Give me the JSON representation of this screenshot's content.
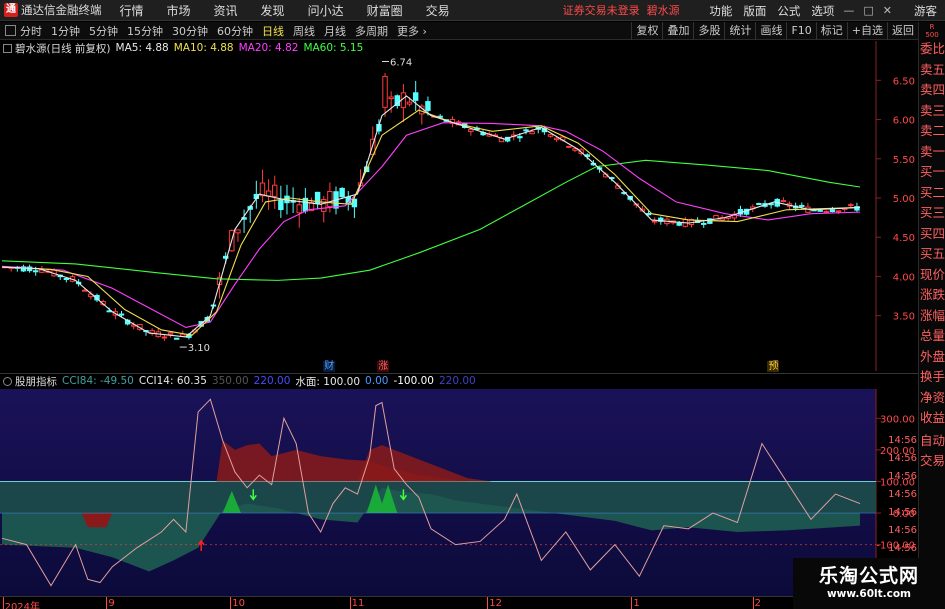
{
  "app": {
    "logo_glyph": "通",
    "title": "通达信金融终端",
    "menus": [
      "行情",
      "市场",
      "资讯",
      "发现",
      "问小达",
      "财富圈",
      "交易"
    ],
    "status": "证券交易未登录",
    "stock": "碧水源",
    "right_menus": [
      "功能",
      "版面",
      "公式",
      "选项"
    ],
    "win_buttons": [
      "—",
      "□",
      "✕"
    ],
    "guest": "游客"
  },
  "toolbar": {
    "timeframes": [
      "分时",
      "1分钟",
      "5分钟",
      "15分钟",
      "30分钟",
      "60分钟",
      "日线",
      "周线",
      "月线",
      "多周期",
      "更多"
    ],
    "active": "日线",
    "more_chevron": "›",
    "right_buttons": [
      "复权",
      "叠加",
      "多股",
      "统计",
      "画线",
      "F10",
      "标记",
      "+自选",
      "返回"
    ]
  },
  "right_panel": {
    "badge_top": "R",
    "badge_bottom": "500",
    "labels": [
      "委比",
      "卖五",
      "卖四",
      "卖三",
      "卖二",
      "卖一",
      "买一",
      "买二",
      "买三",
      "买四",
      "买五",
      "现价",
      "涨跌",
      "涨幅",
      "总量",
      "外盘",
      "换手",
      "净资",
      "收益"
    ],
    "zd_labels": [
      "自动",
      "交易"
    ],
    "times": [
      "14:56",
      "14:56",
      "14:56",
      "14:56",
      "14:56",
      "14:56",
      "14:56",
      "14:56"
    ]
  },
  "main_legend": {
    "title": "碧水源(日线 前复权)",
    "items": [
      {
        "text": "MA5: 4.88",
        "color": "#e8e8e8"
      },
      {
        "text": "MA10: 4.88",
        "color": "#f0e050"
      },
      {
        "text": "MA20: 4.82",
        "color": "#ff40ff"
      },
      {
        "text": "MA60: 5.15",
        "color": "#40ff40"
      }
    ]
  },
  "events": [
    {
      "text": "财",
      "color": "#4aa0ff",
      "bg": "#0a1a3a",
      "at": 0.352
    },
    {
      "text": "涨",
      "color": "#ff6060",
      "bg": "#3a0a0a",
      "at": 0.411
    },
    {
      "text": "预",
      "color": "#ffd040",
      "bg": "#3a2a00",
      "at": 0.836
    }
  ],
  "ind_legend": {
    "title": "股朋指标",
    "items": [
      {
        "text": "CCI84: -49.50",
        "color": "#40a0a0"
      },
      {
        "text": "CCI14: 60.35",
        "color": "#e8e8e8"
      },
      {
        "text": "350.00",
        "color": "#555555"
      },
      {
        "text": "220.00",
        "color": "#4a4aff"
      },
      {
        "text": "水面: 100.00",
        "color": "#e8e8e8"
      },
      {
        "text": "0.00",
        "color": "#4a9aff"
      },
      {
        "text": "-100.00",
        "color": "#ffffff"
      },
      {
        "text": "220.00",
        "color": "#4040c0"
      }
    ]
  },
  "dates": [
    {
      "text": "2024年",
      "at": 0.005
    },
    {
      "text": "9",
      "at": 0.118
    },
    {
      "text": "10",
      "at": 0.253
    },
    {
      "text": "11",
      "at": 0.383
    },
    {
      "text": "12",
      "at": 0.533
    },
    {
      "text": "1",
      "at": 0.69
    },
    {
      "text": "2",
      "at": 0.822
    }
  ],
  "watermark": {
    "line1": "乐淘公式网",
    "line2": "www.60lt.com"
  },
  "chart_data": [
    {
      "type": "candlestick",
      "x_range": [
        0,
        140
      ],
      "ylim": [
        3.05,
        6.95
      ],
      "y_ticks": [
        3.5,
        4.0,
        4.5,
        5.0,
        5.5,
        6.0,
        6.5
      ],
      "annotations": [
        {
          "text": "6.74",
          "x": 62,
          "y": 6.74
        },
        {
          "text": "3.10",
          "x": 29,
          "y": 3.1
        }
      ],
      "ohlc": [],
      "ma": [
        {
          "name": "MA60",
          "color": "#40ff40",
          "values": [
            [
              0,
              4.2
            ],
            [
              12,
              4.16
            ],
            [
              25,
              4.05
            ],
            [
              35,
              3.97
            ],
            [
              45,
              3.95
            ],
            [
              52,
              3.98
            ],
            [
              60,
              4.08
            ],
            [
              68,
              4.3
            ],
            [
              78,
              4.6
            ],
            [
              85,
              4.9
            ],
            [
              92,
              5.2
            ],
            [
              97,
              5.4
            ],
            [
              105,
              5.48
            ],
            [
              115,
              5.42
            ],
            [
              125,
              5.35
            ],
            [
              135,
              5.2
            ],
            [
              140,
              5.14
            ]
          ]
        },
        {
          "name": "MA20",
          "color": "#ff40ff",
          "values": [
            [
              0,
              4.13
            ],
            [
              10,
              4.08
            ],
            [
              18,
              3.85
            ],
            [
              24,
              3.6
            ],
            [
              30,
              3.35
            ],
            [
              34,
              3.42
            ],
            [
              38,
              3.9
            ],
            [
              42,
              4.35
            ],
            [
              46,
              4.7
            ],
            [
              50,
              4.85
            ],
            [
              56,
              4.9
            ],
            [
              62,
              5.4
            ],
            [
              66,
              5.8
            ],
            [
              72,
              5.96
            ],
            [
              80,
              5.95
            ],
            [
              88,
              5.92
            ],
            [
              92,
              5.85
            ],
            [
              98,
              5.6
            ],
            [
              104,
              5.25
            ],
            [
              110,
              4.95
            ],
            [
              118,
              4.8
            ],
            [
              125,
              4.72
            ],
            [
              132,
              4.8
            ],
            [
              140,
              4.82
            ]
          ]
        },
        {
          "name": "MA10",
          "color": "#f0e050",
          "values": [
            [
              0,
              4.12
            ],
            [
              8,
              4.09
            ],
            [
              14,
              4.0
            ],
            [
              20,
              3.58
            ],
            [
              26,
              3.32
            ],
            [
              31,
              3.25
            ],
            [
              35,
              3.55
            ],
            [
              39,
              4.4
            ],
            [
              43,
              4.95
            ],
            [
              47,
              5.0
            ],
            [
              52,
              4.95
            ],
            [
              57,
              4.92
            ],
            [
              62,
              5.8
            ],
            [
              68,
              6.12
            ],
            [
              74,
              5.95
            ],
            [
              80,
              5.85
            ],
            [
              88,
              5.92
            ],
            [
              94,
              5.7
            ],
            [
              100,
              5.3
            ],
            [
              106,
              4.8
            ],
            [
              112,
              4.72
            ],
            [
              120,
              4.7
            ],
            [
              128,
              4.85
            ],
            [
              140,
              4.88
            ]
          ]
        },
        {
          "name": "MA5",
          "color": "#e8e8e8",
          "values": [
            [
              0,
              4.12
            ],
            [
              6,
              4.1
            ],
            [
              12,
              3.95
            ],
            [
              18,
              3.55
            ],
            [
              24,
              3.28
            ],
            [
              30,
              3.23
            ],
            [
              34,
              3.5
            ],
            [
              38,
              4.6
            ],
            [
              42,
              5.05
            ],
            [
              46,
              4.98
            ],
            [
              52,
              4.92
            ],
            [
              58,
              5.05
            ],
            [
              62,
              6.05
            ],
            [
              66,
              6.3
            ],
            [
              70,
              6.05
            ],
            [
              76,
              5.9
            ],
            [
              82,
              5.75
            ],
            [
              88,
              5.9
            ],
            [
              94,
              5.62
            ],
            [
              100,
              5.2
            ],
            [
              106,
              4.72
            ],
            [
              112,
              4.68
            ],
            [
              118,
              4.75
            ],
            [
              126,
              4.95
            ],
            [
              132,
              4.85
            ],
            [
              140,
              4.88
            ]
          ]
        }
      ]
    },
    {
      "type": "line",
      "ylim": [
        -250,
        380
      ],
      "y_ticks": [
        300,
        200,
        100,
        0,
        -100,
        -200
      ],
      "series": [
        {
          "name": "CCI84",
          "color": "#1e5850",
          "values": [
            [
              0,
              -100
            ],
            [
              12,
              -110
            ],
            [
              18,
              -140
            ],
            [
              24,
              -185
            ],
            [
              28,
              -150
            ],
            [
              32,
              -110
            ],
            [
              36,
              10
            ],
            [
              40,
              30
            ],
            [
              45,
              15
            ],
            [
              52,
              -20
            ],
            [
              58,
              -30
            ],
            [
              62,
              80
            ],
            [
              66,
              65
            ],
            [
              70,
              60
            ],
            [
              74,
              40
            ],
            [
              80,
              25
            ],
            [
              90,
              0
            ],
            [
              100,
              -25
            ],
            [
              106,
              -55
            ],
            [
              112,
              -45
            ],
            [
              120,
              -60
            ],
            [
              128,
              -55
            ],
            [
              136,
              -45
            ],
            [
              140,
              -40
            ]
          ]
        },
        {
          "name": "CCI14",
          "color": "#e0a0a0",
          "values": [
            [
              0,
              -80
            ],
            [
              4,
              -100
            ],
            [
              8,
              -230
            ],
            [
              12,
              -100
            ],
            [
              14,
              -210
            ],
            [
              16,
              -220
            ],
            [
              18,
              -170
            ],
            [
              22,
              -110
            ],
            [
              26,
              -60
            ],
            [
              28,
              -20
            ],
            [
              30,
              -60
            ],
            [
              32,
              320
            ],
            [
              34,
              360
            ],
            [
              36,
              230
            ],
            [
              38,
              130
            ],
            [
              40,
              80
            ],
            [
              42,
              120
            ],
            [
              44,
              90
            ],
            [
              46,
              300
            ],
            [
              48,
              220
            ],
            [
              50,
              0
            ],
            [
              52,
              -60
            ],
            [
              54,
              30
            ],
            [
              56,
              80
            ],
            [
              58,
              60
            ],
            [
              60,
              180
            ],
            [
              61,
              340
            ],
            [
              62,
              350
            ],
            [
              64,
              140
            ],
            [
              66,
              90
            ],
            [
              68,
              50
            ],
            [
              70,
              -50
            ],
            [
              74,
              -100
            ],
            [
              78,
              -90
            ],
            [
              82,
              -20
            ],
            [
              84,
              60
            ],
            [
              88,
              -150
            ],
            [
              92,
              -60
            ],
            [
              96,
              -180
            ],
            [
              100,
              -100
            ],
            [
              104,
              -200
            ],
            [
              108,
              -40
            ],
            [
              112,
              -50
            ],
            [
              116,
              0
            ],
            [
              120,
              -30
            ],
            [
              124,
              220
            ],
            [
              128,
              100
            ],
            [
              132,
              -20
            ],
            [
              136,
              60
            ],
            [
              140,
              30
            ]
          ]
        }
      ],
      "water_level": 100,
      "markers": [
        {
          "type": "up",
          "color": "#ff2020",
          "x": 32.5
        },
        {
          "type": "down",
          "color": "#40ff40",
          "x": 41
        },
        {
          "type": "down",
          "color": "#40ff40",
          "x": 65.5
        }
      ]
    }
  ]
}
